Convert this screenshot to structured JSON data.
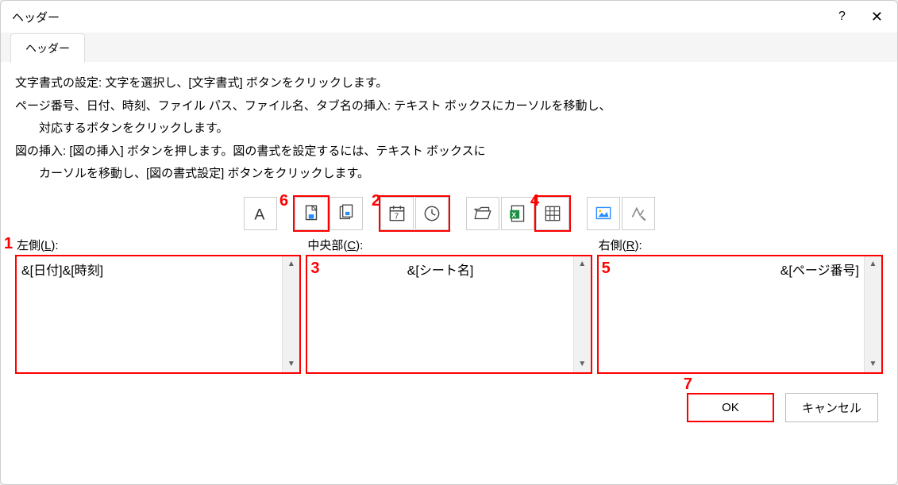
{
  "dialog": {
    "title": "ヘッダー",
    "tab": "ヘッダー"
  },
  "instructions": {
    "line1": "文字書式の設定: 文字を選択し、[文字書式] ボタンをクリックします。",
    "line2": "ページ番号、日付、時刻、ファイル パス、ファイル名、タブ名の挿入: テキスト ボックスにカーソルを移動し、",
    "line3": "対応するボタンをクリックします。",
    "line4": "図の挿入: [図の挿入] ボタンを押します。図の書式を設定するには、テキスト ボックスに",
    "line5": "カーソルを移動し、[図の書式設定] ボタンをクリックします。"
  },
  "sections": {
    "left": {
      "label_pre": "左側(",
      "label_key": "L",
      "label_post": "):",
      "value": "&[日付]&[時刻]"
    },
    "center": {
      "label_pre": "中央部(",
      "label_key": "C",
      "label_post": "):",
      "value": "&[シート名]"
    },
    "right": {
      "label_pre": "右側(",
      "label_key": "R",
      "label_post": "):",
      "value": "&[ページ番号]"
    }
  },
  "buttons": {
    "ok": "OK",
    "cancel": "キャンセル"
  },
  "annotations": {
    "n1": "1",
    "n2": "2",
    "n3": "3",
    "n4": "4",
    "n5": "5",
    "n6": "6",
    "n7": "7"
  }
}
